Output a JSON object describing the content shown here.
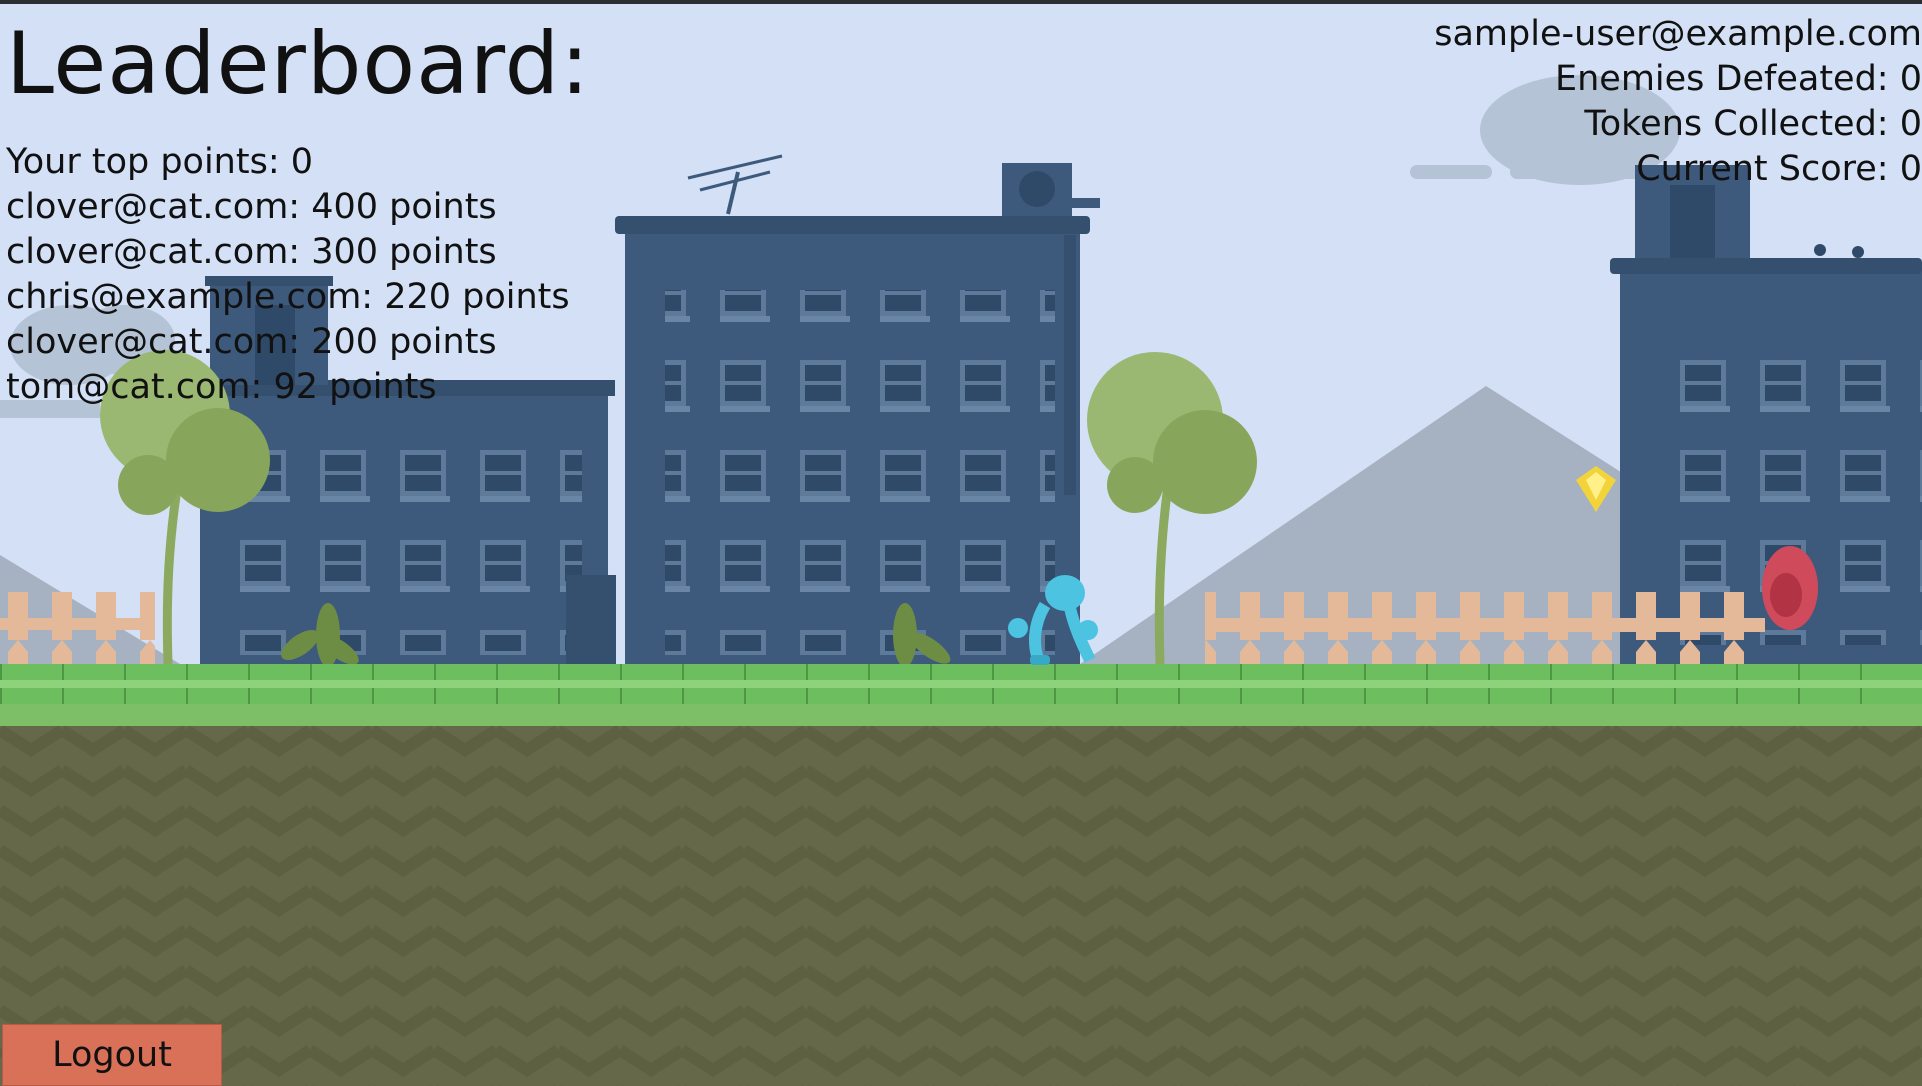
{
  "leaderboard": {
    "title": "Leaderboard:",
    "lines": [
      "Your top points: 0",
      "clover@cat.com: 400 points",
      "clover@cat.com: 300 points",
      "chris@example.com: 220 points",
      "clover@cat.com: 200 points",
      "tom@cat.com: 92 points"
    ]
  },
  "stats": {
    "user": "sample-user@example.com",
    "enemies": "Enemies Defeated: 0",
    "tokens": "Tokens Collected: 0",
    "score": "Current Score: 0"
  },
  "logout_label": "Logout",
  "colors": {
    "sky": "#d3e0f5",
    "building": "#3d5a7d",
    "grass": "#5fae54",
    "dirt": "#66684a",
    "logout_button": "#d97158",
    "player": "#4cc3e0",
    "enemy": "#cf4a5a",
    "token": "#f2d43a"
  }
}
